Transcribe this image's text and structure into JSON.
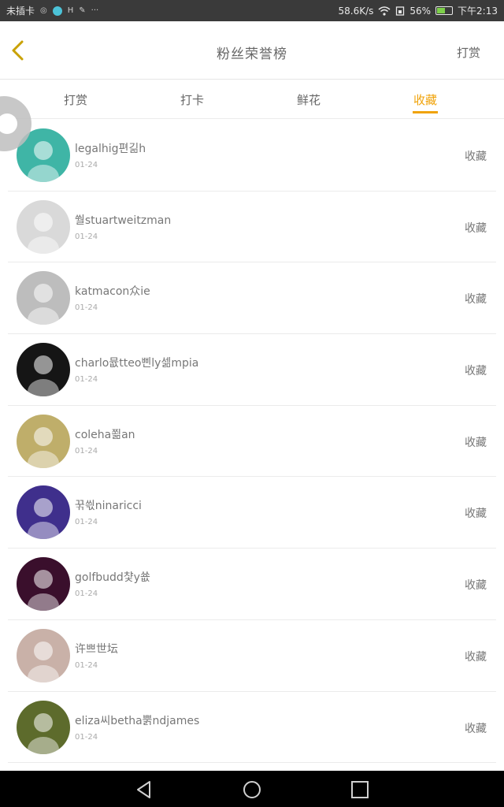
{
  "status_bar": {
    "carrier": "未插卡",
    "icons": [
      "notification-icon",
      "moon-icon",
      "app-icon",
      "settings-icon",
      "more-icon"
    ],
    "more": "···",
    "network_speed": "58.6K/s",
    "battery_percent": "56%",
    "battery_level": 0.56,
    "time": "下午2:13"
  },
  "header": {
    "title": "粉丝荣誉榜",
    "action": "打赏"
  },
  "tabs": [
    {
      "label": "打赏",
      "active": false
    },
    {
      "label": "打卡",
      "active": false
    },
    {
      "label": "鲜花",
      "active": false
    },
    {
      "label": "收藏",
      "active": true
    }
  ],
  "colors": {
    "accent": "#f0a30a",
    "status_bar": "#3a3a3a",
    "nav_bar": "#000000"
  },
  "list": {
    "items": [
      {
        "name": "legalhig편긺h",
        "date": "01-24",
        "action": "收藏",
        "avatar_bg": "#3fb5a6"
      },
      {
        "name": "쒈stuartweitzman",
        "date": "01-24",
        "action": "收藏",
        "avatar_bg": "#d9d9d9"
      },
      {
        "name": "katmacon众ie",
        "date": "01-24",
        "action": "收藏",
        "avatar_bg": "#bdbdbd"
      },
      {
        "name": "charlo뮶tteo삔ly셂mpia",
        "date": "01-24",
        "action": "收藏",
        "avatar_bg": "#151515"
      },
      {
        "name": "coleha쬚an",
        "date": "01-24",
        "action": "收藏",
        "avatar_bg": "#bfae6a"
      },
      {
        "name": "꾺씏ninaricci",
        "date": "01-24",
        "action": "收藏",
        "avatar_bg": "#3f2f8c"
      },
      {
        "name": "golfbudd챷y쑚",
        "date": "01-24",
        "action": "收藏",
        "avatar_bg": "#3a0f2c"
      },
      {
        "name": "许쁘世坛",
        "date": "01-24",
        "action": "收藏",
        "avatar_bg": "#c9b1a8"
      },
      {
        "name": "eliza씨betha뿕ndjames",
        "date": "01-24",
        "action": "收藏",
        "avatar_bg": "#5d6b2c"
      }
    ]
  },
  "nav_bar": {
    "buttons": [
      "back-triangle-icon",
      "home-circle-icon",
      "recents-square-icon"
    ]
  }
}
